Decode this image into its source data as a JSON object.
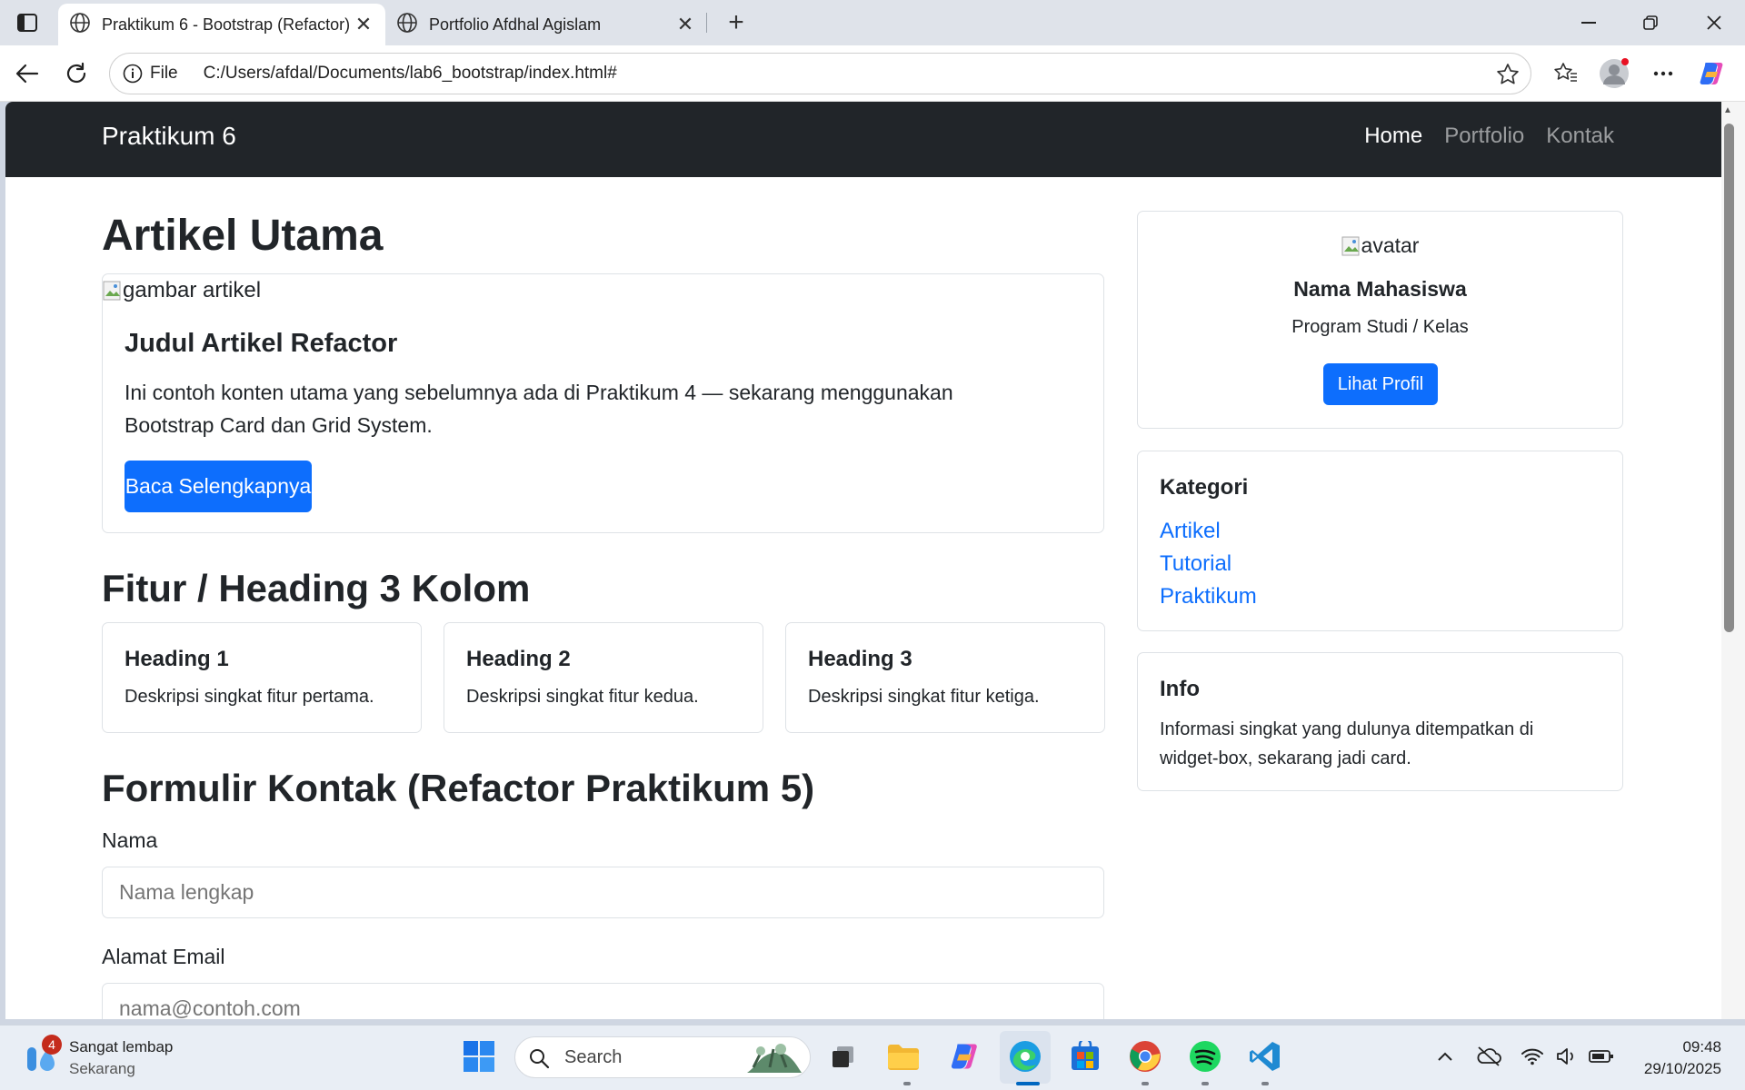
{
  "browser": {
    "tabs": [
      {
        "title": "Praktikum 6 - Bootstrap (Refactor)",
        "active": true
      },
      {
        "title": "Portfolio Afdhal Agislam",
        "active": false
      }
    ],
    "address": {
      "scheme": "File",
      "url": "C:/Users/afdal/Documents/lab6_bootstrap/index.html#"
    }
  },
  "page": {
    "navbar": {
      "brand": "Praktikum 6",
      "links": [
        "Home",
        "Portfolio",
        "Kontak"
      ]
    },
    "main": {
      "heading": "Artikel Utama",
      "article": {
        "image_alt": "gambar artikel",
        "title": "Judul Artikel Refactor",
        "text_line1": "Ini contoh konten utama yang sebelumnya ada di Praktikum 4 — sekarang menggunakan",
        "text_line2": "Bootstrap Card dan Grid System.",
        "button": "Baca Selengkapnya"
      },
      "features_heading": "Fitur / Heading 3 Kolom",
      "features": [
        {
          "title": "Heading 1",
          "text": "Deskripsi singkat fitur pertama."
        },
        {
          "title": "Heading 2",
          "text": "Deskripsi singkat fitur kedua."
        },
        {
          "title": "Heading 3",
          "text": "Deskripsi singkat fitur ketiga."
        }
      ],
      "form_heading": "Formulir Kontak (Refactor Praktikum 5)",
      "form": {
        "name_label": "Nama",
        "name_placeholder": "Nama lengkap",
        "email_label": "Alamat Email",
        "email_placeholder": "nama@contoh.com"
      }
    },
    "sidebar": {
      "profile": {
        "avatar_alt": "avatar",
        "name": "Nama Mahasiswa",
        "program": "Program Studi / Kelas",
        "button": "Lihat Profil"
      },
      "kategori": {
        "title": "Kategori",
        "links": [
          "Artikel",
          "Tutorial",
          "Praktikum"
        ]
      },
      "info": {
        "title": "Info",
        "line1": "Informasi singkat yang dulunya ditempatkan di",
        "line2": "widget-box, sekarang jadi card."
      }
    }
  },
  "taskbar": {
    "weather": {
      "badge": "4",
      "title": "Sangat lembap",
      "subtitle": "Sekarang"
    },
    "search_placeholder": "Search",
    "time": "09:48",
    "date": "29/10/2025"
  },
  "colors": {
    "primary": "#0d6efd",
    "navbar_bg": "#212529",
    "link": "#0d6efd"
  }
}
